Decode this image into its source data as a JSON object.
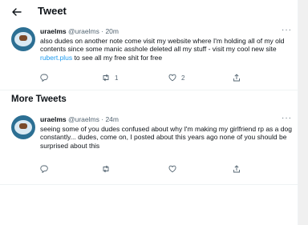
{
  "header": {
    "title": "Tweet",
    "back_icon": "arrow-left-icon"
  },
  "section": {
    "more_tweets": "More Tweets"
  },
  "tweets": [
    {
      "name": "uraelms",
      "handle": "@uraelms",
      "separator": "·",
      "time": "20m",
      "text_before_link": "also dudes on another note come visit my website where I'm holding all of my old contents since some manic asshole deleted all my stuff - visit my cool new site ",
      "link": "rubert.plus",
      "text_after_link": " to see all my free shit for free",
      "reply_count": "",
      "retweet_count": "1",
      "like_count": "2",
      "more": "···"
    },
    {
      "name": "uraelms",
      "handle": "@uraelms",
      "separator": "·",
      "time": "24m",
      "text": "seeing some of you dudes confused about why I'm making my girlfriend rp as a dog constantly... dudes, come on, I posted about this years ago none of you should be surprised about this",
      "reply_count": "",
      "retweet_count": "",
      "like_count": "",
      "more": "···"
    }
  ],
  "colors": {
    "link": "#1d9bf0",
    "secondary": "#536471",
    "text": "#0f1419"
  }
}
